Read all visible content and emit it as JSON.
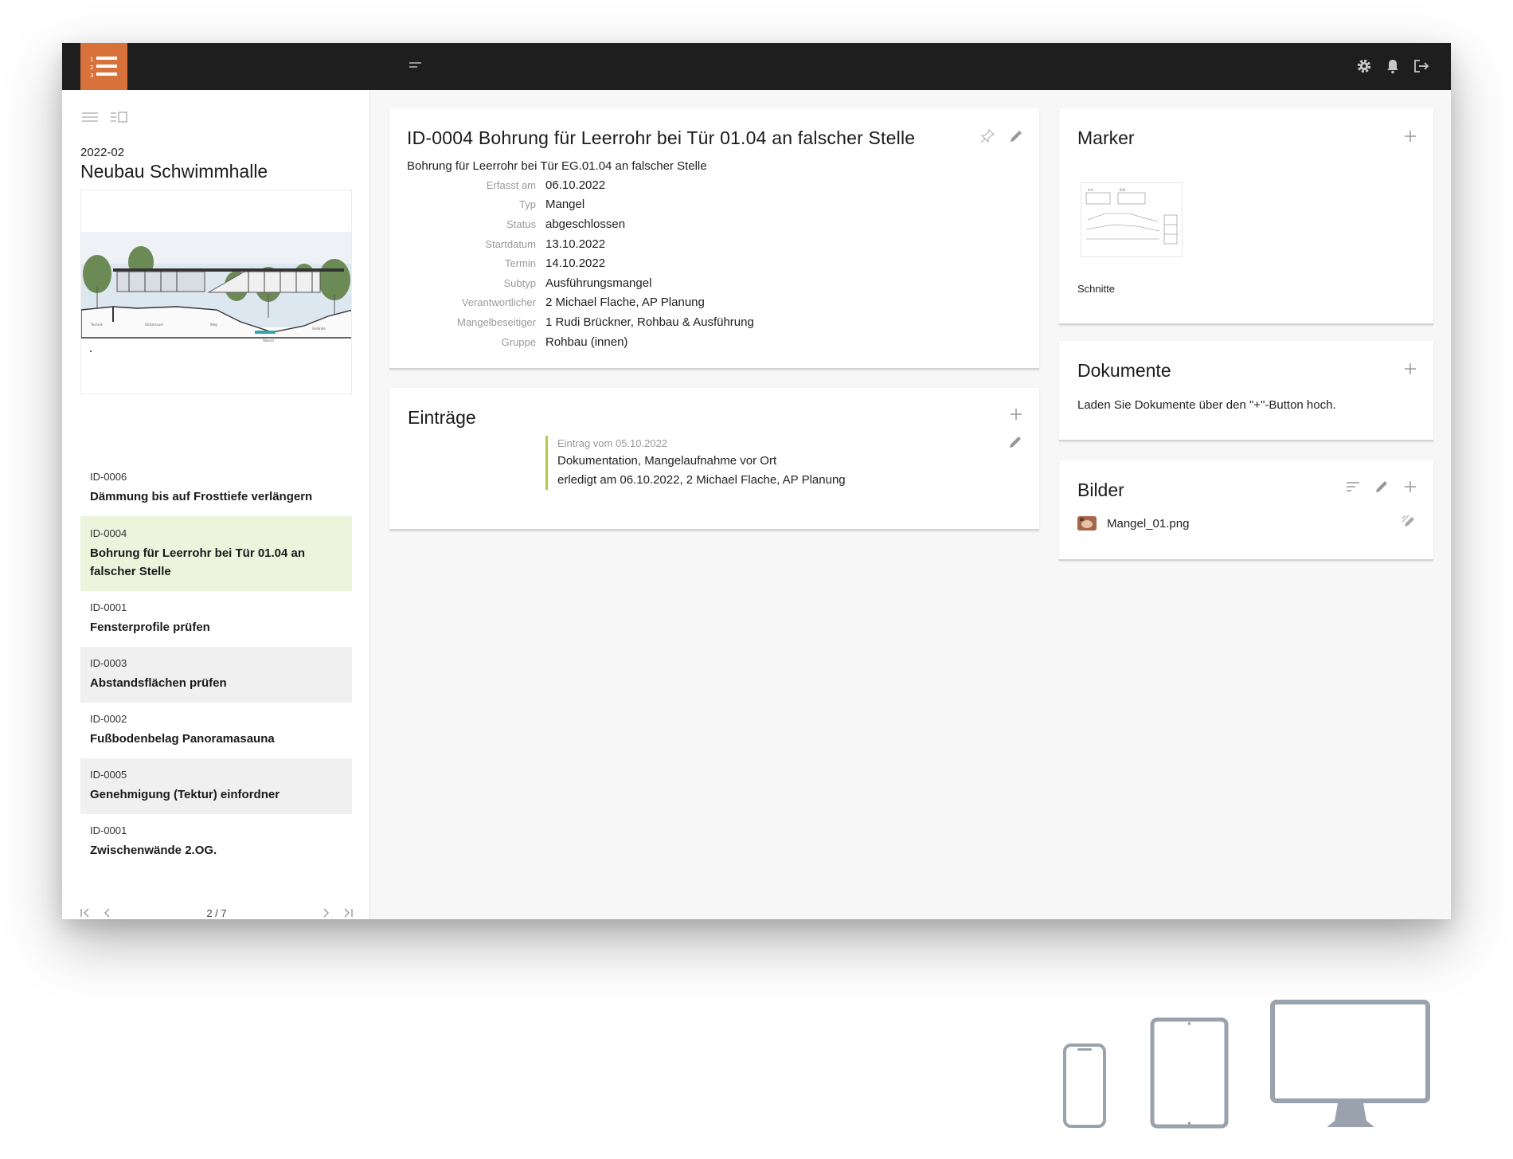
{
  "colors": {
    "brand": "#d9713a",
    "topbar": "#1e1e1e",
    "active_row": "#eef3dc",
    "entry_accent": "#b8c948",
    "device_icons": "#9aa2ad"
  },
  "sidebar": {
    "project_code": "2022-02",
    "project_name": "Neubau Schwimmhalle",
    "items": [
      {
        "id": "ID-0006",
        "title": "Dämmung bis auf Frosttiefe verlängern"
      },
      {
        "id": "ID-0004",
        "title": "Bohrung für Leerrohr bei Tür 01.04 an falscher Stelle"
      },
      {
        "id": "ID-0001",
        "title": "Fensterprofile prüfen"
      },
      {
        "id": "ID-0003",
        "title": "Abstandsflächen prüfen"
      },
      {
        "id": "ID-0002",
        "title": "Fußbodenbelag Panoramasauna"
      },
      {
        "id": "ID-0005",
        "title": "Genehmigung (Tektur) einfordner"
      },
      {
        "id": "ID-0001",
        "title": "Zwischenwände 2.OG."
      }
    ],
    "pager": "2 / 7"
  },
  "detail": {
    "title": "ID-0004 Bohrung für Leerrohr bei Tür 01.04 an falscher Stelle",
    "subtitle": "Bohrung für Leerrohr bei Tür EG.01.04 an falscher Stelle",
    "fields": [
      {
        "label": "Erfasst am",
        "value": "06.10.2022"
      },
      {
        "label": "Typ",
        "value": "Mangel"
      },
      {
        "label": "Status",
        "value": "abgeschlossen"
      },
      {
        "label": "Startdatum",
        "value": "13.10.2022"
      },
      {
        "label": "Termin",
        "value": "14.10.2022"
      },
      {
        "label": "Subtyp",
        "value": "Ausführungsmangel"
      },
      {
        "label": "Verantwortlicher",
        "value": "2 Michael Flache, AP Planung"
      },
      {
        "label": "Mangelbeseitiger",
        "value": "1 Rudi Brückner, Rohbau & Ausführung"
      },
      {
        "label": "Gruppe",
        "value": "Rohbau (innen)"
      }
    ]
  },
  "entries": {
    "title": "Einträge",
    "items": [
      {
        "date": "Eintrag vom 05.10.2022",
        "text": "Dokumentation, Mangelaufnahme vor Ort",
        "done": "erledigt am 06.10.2022, 2 Michael Flache, AP Planung"
      }
    ]
  },
  "marker": {
    "title": "Marker",
    "thumb_label": "Schnitte"
  },
  "documents": {
    "title": "Dokumente",
    "empty_text": "Laden Sie Dokumente über den \"+\"-Button hoch."
  },
  "images": {
    "title": "Bilder",
    "files": [
      {
        "name": "Mangel_01.png"
      }
    ]
  }
}
